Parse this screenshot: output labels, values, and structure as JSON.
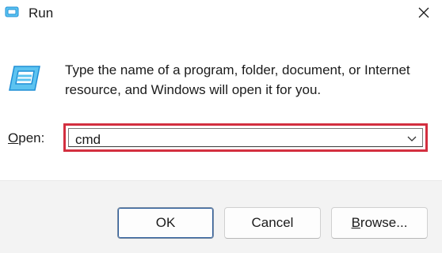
{
  "window": {
    "title": "Run",
    "close_icon": "close-icon",
    "app_icon": "run-icon"
  },
  "body": {
    "icon": "run-icon",
    "description": "Type the name of a program, folder, document, or Internet resource, and Windows will open it for you.",
    "open_label_accel": "O",
    "open_label_rest": "pen:",
    "open_value": "cmd",
    "dropdown_icon": "chevron-down-icon"
  },
  "buttons": {
    "ok_label": "OK",
    "cancel_label": "Cancel",
    "browse_label_accel": "B",
    "browse_label_rest": "rowse..."
  },
  "colors": {
    "highlight": "#d32f3f",
    "icon_blue": "#1e8fd6",
    "footer_bg": "#f3f3f3"
  }
}
